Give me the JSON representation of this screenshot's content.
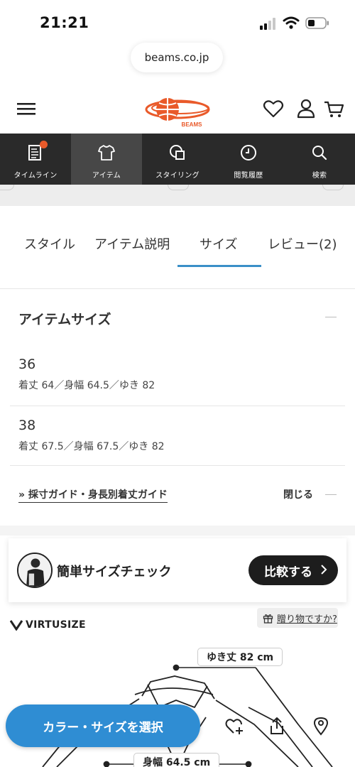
{
  "status_bar": {
    "time": "21:21"
  },
  "browser": {
    "url": "beams.co.jp"
  },
  "header": {
    "logo_alt": "BEAMS"
  },
  "nav": [
    {
      "label": "タイムライン",
      "icon": "timeline-icon",
      "badge": true
    },
    {
      "label": "アイテム",
      "icon": "shirt-icon",
      "active": true
    },
    {
      "label": "スタイリング",
      "icon": "styling-icon"
    },
    {
      "label": "閲覧履歴",
      "icon": "clock-icon"
    },
    {
      "label": "検索",
      "icon": "search-icon"
    }
  ],
  "tabs": [
    {
      "label": "スタイル"
    },
    {
      "label": "アイテム説明"
    },
    {
      "label": "サイズ",
      "active": true
    },
    {
      "label": "レビュー(2)"
    }
  ],
  "item_size": {
    "title": "アイテムサイズ",
    "sizes": [
      {
        "label": "36",
        "desc": "着丈 64／身幅 64.5／ゆき 82"
      },
      {
        "label": "38",
        "desc": "着丈 67.5／身幅 67.5／ゆき 82"
      }
    ],
    "guide_link": "» 採寸ガイド・身長別着丈ガイド",
    "close_label": "閉じる"
  },
  "size_check": {
    "title": "簡単サイズチェック",
    "compare_label": "比較する"
  },
  "virtusize": {
    "brand": "VIRTUSIZE",
    "gift_label": "贈り物ですか?"
  },
  "diagram": {
    "sleeve_label": "ゆき丈 82 cm",
    "width_label": "身幅 64.5 cm"
  },
  "bottom_bar": {
    "select_label": "カラー・サイズを選択"
  },
  "colors": {
    "accent_blue": "#2f8dd3",
    "brand_orange": "#e95a2a",
    "nav_dark": "#2a2a2a"
  }
}
